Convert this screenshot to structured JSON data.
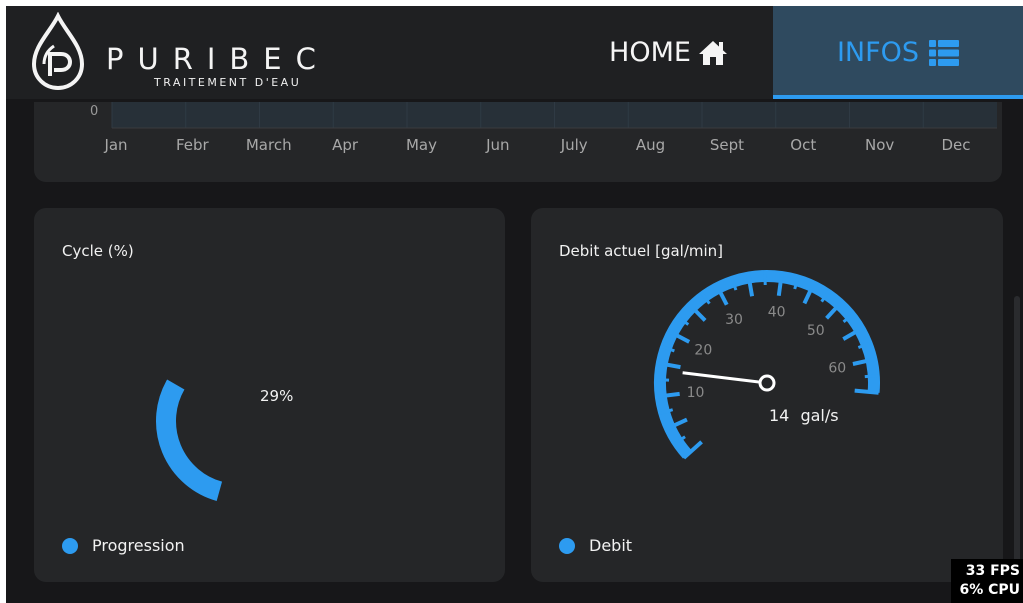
{
  "header": {
    "brand_name": "PURIBEC",
    "brand_subtitle": "TRAITEMENT D'EAU",
    "nav": [
      {
        "label": "HOME",
        "icon": "home-icon",
        "active": false
      },
      {
        "label": "INFOS",
        "icon": "list-icon",
        "active": true
      }
    ]
  },
  "monthly_chart": {
    "y_tick": "0",
    "months": [
      "Jan",
      "Febr",
      "March",
      "Apr",
      "May",
      "Jun",
      "July",
      "Aug",
      "Sept",
      "Oct",
      "Nov",
      "Dec"
    ]
  },
  "cycle": {
    "title": "Cycle (%)",
    "value_label": "29%",
    "progress": 29,
    "legend": "Progression"
  },
  "debit": {
    "title": "Debit actuel [gal/min]",
    "value": 14,
    "unit": "gal/s",
    "scale_labels": [
      "10",
      "20",
      "30",
      "40",
      "50",
      "60"
    ],
    "legend": "Debit"
  },
  "perf": {
    "fps": "33 FPS",
    "cpu": "6% CPU"
  },
  "colors": {
    "accent": "#2d9bf0",
    "active_tab": "#2f4a5f",
    "card": "#252628",
    "background": "#171719"
  }
}
